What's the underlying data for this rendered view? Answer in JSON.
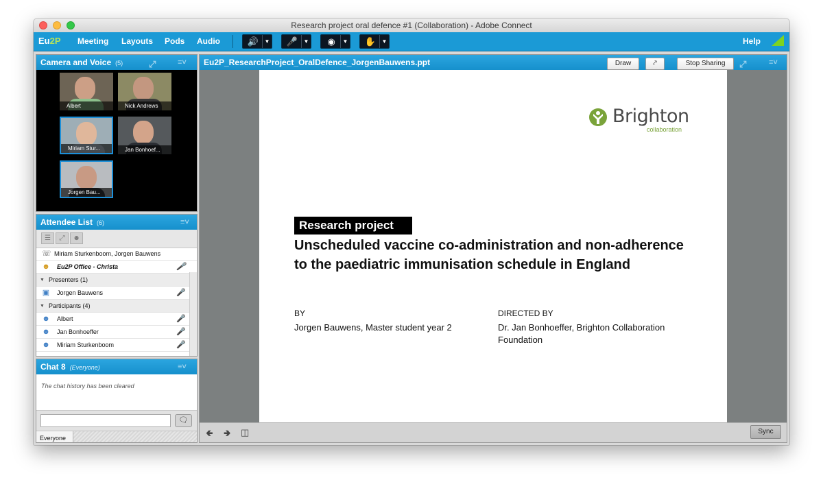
{
  "window": {
    "title": "Research project oral defence #1 (Collaboration) - Adobe Connect"
  },
  "menubar": {
    "logo_main": "Eu",
    "logo_accent": "2P",
    "items": [
      "Meeting",
      "Layouts",
      "Pods",
      "Audio"
    ],
    "help": "Help",
    "buttons": {
      "speaker_icon": "speaker-icon",
      "mic_icon": "microphone-muted-icon",
      "webcam_icon": "webcam-icon",
      "status_icon": "raise-hand-icon"
    },
    "colors": {
      "bar": "#1b9ad6",
      "speaker_on": "#7ed321"
    }
  },
  "camera_pod": {
    "title": "Camera and Voice",
    "count": "(5)",
    "tiles": [
      {
        "name": "Albert"
      },
      {
        "name": "Nick Andrews"
      },
      {
        "name": "Miriam Stur..."
      },
      {
        "name": "Jan Bonhoef..."
      },
      {
        "name": "Jorgen Bau..."
      }
    ]
  },
  "attendee_pod": {
    "title": "Attendee List",
    "count": "(6)",
    "speaking_now": "Miriam Sturkenboom, Jorgen Bauwens",
    "host": "Eu2P Office - Christa",
    "presenters_header": "Presenters (1)",
    "presenters": [
      "Jorgen Bauwens"
    ],
    "participants_header": "Participants (4)",
    "participants": [
      "Albert",
      "Jan Bonhoeffer",
      "Miriam Sturkenboom"
    ]
  },
  "chat_pod": {
    "title": "Chat 8",
    "scope": "(Everyone)",
    "message": "The chat history has been cleared",
    "input_placeholder": "",
    "tab": "Everyone"
  },
  "share_pod": {
    "title": "Eu2P_ResearchProject_OralDefence_JorgenBauwens.ppt",
    "draw_button": "Draw",
    "stop_button": "Stop Sharing",
    "sync_button": "Sync"
  },
  "slide": {
    "logo_name": "Brighton",
    "logo_sub": "collaboration",
    "tag": "Research project",
    "title_line1": "Unscheduled vaccine co-administration and non-adherence",
    "title_line2": "to the paediatric immunisation schedule in England",
    "by_label": "BY",
    "by_text": "Jorgen Bauwens, Master student year 2",
    "directed_label": "DIRECTED BY",
    "directed_line1": "Dr. Jan Bonhoeffer, Brighton Collaboration",
    "directed_line2": "Foundation"
  }
}
